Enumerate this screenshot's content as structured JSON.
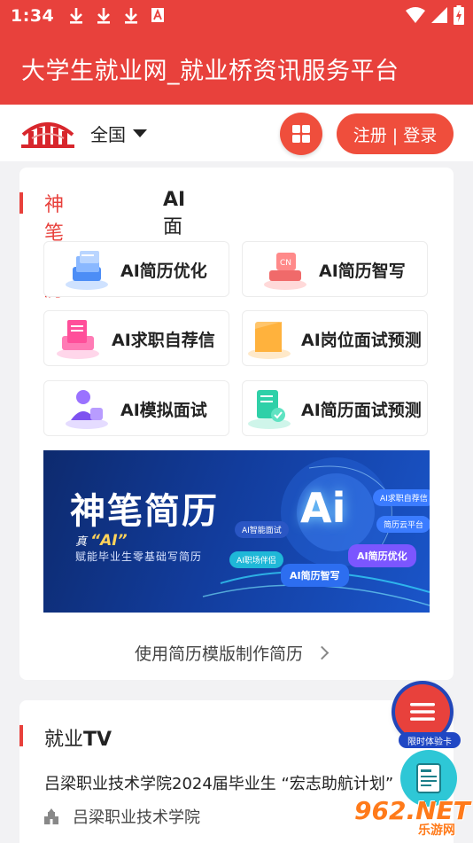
{
  "status_bar": {
    "time": "1:34",
    "icons_left": [
      "download-icon",
      "download-icon",
      "download-icon",
      "text-a-icon"
    ],
    "icons_right": [
      "wifi-icon",
      "signal-icon",
      "battery-icon"
    ]
  },
  "app_bar": {
    "title": "大学生就业网_就业桥资讯服务平台"
  },
  "top_nav": {
    "region": "全国",
    "login_label": "注册 | 登录"
  },
  "resume_card": {
    "tabs": [
      {
        "label": "神笔简历",
        "active": true
      },
      {
        "label_prefix": "AI",
        "label_suffix": "面试",
        "active": false
      }
    ],
    "features": [
      {
        "label": "AI简历优化",
        "icon": "document-stack-icon"
      },
      {
        "label": "AI简历智写",
        "icon": "cn-stamp-icon"
      },
      {
        "label": "AI求职自荐信",
        "icon": "letter-icon"
      },
      {
        "label": "AI岗位面试预测",
        "icon": "folder-icon"
      },
      {
        "label": "AI模拟面试",
        "icon": "interview-person-icon"
      },
      {
        "label": "AI简历面试预测",
        "icon": "checklist-icon"
      }
    ],
    "banner": {
      "title": "神笔简历",
      "sub_prefix": "真",
      "sub_ai": "“AI”",
      "sub_line2": "赋能毕业生零基础写简历",
      "ai_word": "Ai",
      "pills": [
        "AI求职自荐信",
        "AI智能面试",
        "简历云平台",
        "AI职场伴侣",
        "AI简历优化",
        "AI简历智写"
      ]
    },
    "template_link": "使用简历模版制作简历"
  },
  "tv_section": {
    "title_prefix": "就业",
    "title_suffix": "TV",
    "news_title": "吕梁职业技术学院2024届毕业生 “宏志助航计划”",
    "news_source": "吕梁职业技术学院"
  },
  "floating": {
    "badge": "限时体验卡"
  },
  "watermark": {
    "main": "962.NET",
    "sub": "乐游网"
  },
  "colors": {
    "primary": "#e8413c",
    "accent_blue": "#1f47c4",
    "teal": "#2ec7d6"
  }
}
